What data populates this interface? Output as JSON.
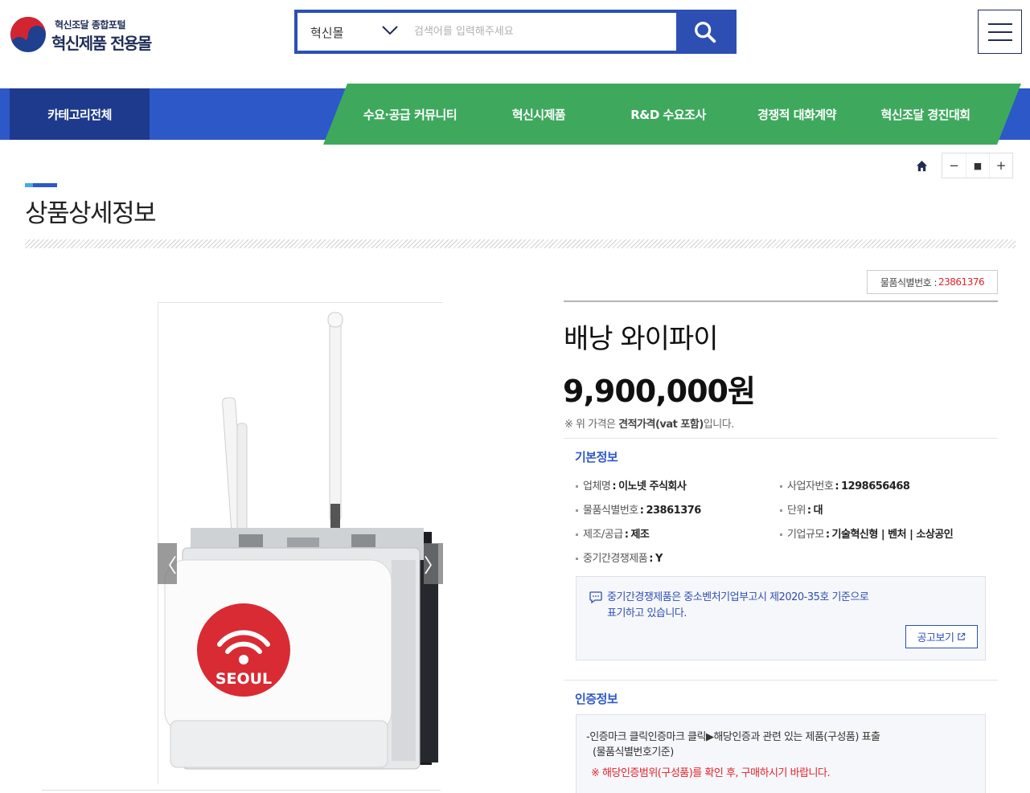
{
  "header": {
    "logo_subtitle": "혁신조달 종합포털",
    "logo_title": "혁신제품 전용몰",
    "search": {
      "scope": "혁신몰",
      "placeholder": "검색어를 입력해주세요"
    }
  },
  "nav": {
    "category_all": "카테고리전체",
    "items": [
      "수요·공급 커뮤니티",
      "혁신시제품",
      "R&D 수요조사",
      "경쟁적 대화계약",
      "혁신조달 경진대회"
    ]
  },
  "page": {
    "title": "상품상세정보"
  },
  "utility": {
    "zoom_out": "−",
    "zoom_reset": "■",
    "zoom_in": "+"
  },
  "gallery": {
    "prev": "〈",
    "next": "〉",
    "image_label": "SEOUL"
  },
  "product": {
    "id_label": "물품식별번호 :",
    "id_value": "23861376",
    "name": "배낭 와이파이",
    "price": "9,900,000원",
    "price_note_prefix": "※ 위 가격은 ",
    "price_note_bold": "견적가격(vat 포함)",
    "price_note_suffix": "입니다."
  },
  "basic_info": {
    "title": "기본정보",
    "rows": [
      {
        "label": "업체명",
        "value": "이노넷 주식회사"
      },
      {
        "label": "사업자번호",
        "value": "1298656468"
      },
      {
        "label": "물품식별번호",
        "value": "23861376"
      },
      {
        "label": "단위",
        "value": "대"
      },
      {
        "label": "제조/공급",
        "value": "제조"
      },
      {
        "label": "기업규모",
        "value": "기술혁신형 | 벤처 | 소상공인"
      },
      {
        "label": "중기간경쟁제품",
        "value": "Y"
      }
    ],
    "notice": {
      "line1": "중기간경쟁제품은 중소벤처기업부고시 제2020-35호 기준으로",
      "line2": "표기하고 있습니다.",
      "button": "공고보기"
    }
  },
  "cert_info": {
    "title": "인증정보",
    "line1": "-인증마크 클릭인증마크 클릭▶해당인증과 관련 있는 제품(구성품) 표출",
    "line2": "(물품식별번호기준)",
    "warning": "※ 해당인증범위(구성품)를 확인 후, 구매하시기 바랍니다."
  },
  "colors": {
    "brand_blue": "#2d58c8",
    "dark_blue": "#1e3a8c",
    "nav_green": "#3ea95d",
    "accent_red": "#e0242a"
  }
}
